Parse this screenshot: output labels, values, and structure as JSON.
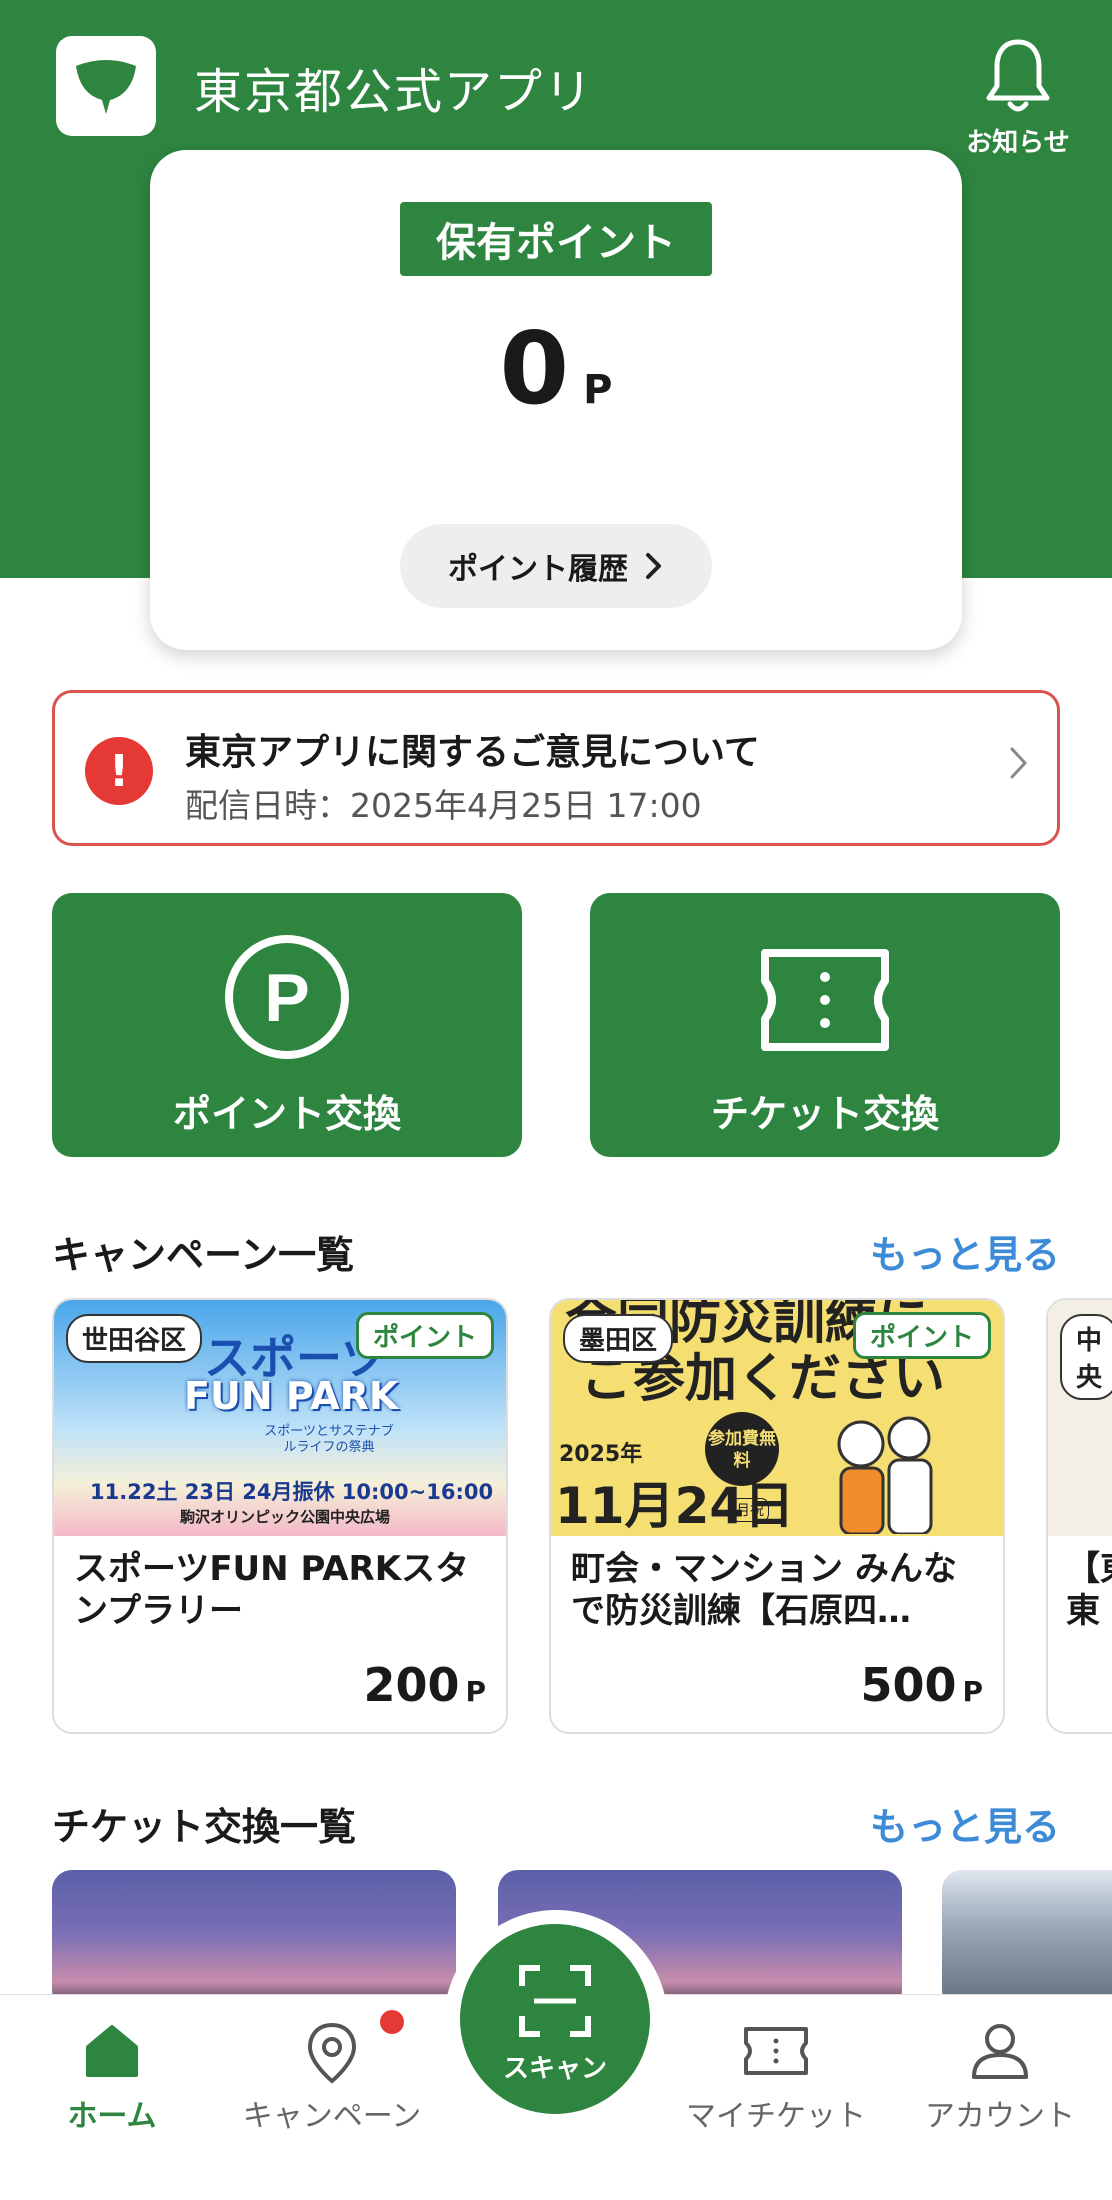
{
  "header": {
    "app_title": "東京都公式アプリ",
    "notification_label": "お知らせ"
  },
  "points": {
    "badge": "保有ポイント",
    "value": "0",
    "unit": "P",
    "history_label": "ポイント履歴"
  },
  "notice": {
    "title": "東京アプリに関するご意見について",
    "date": "配信日時：2025年4月25日 17:00"
  },
  "tiles": {
    "point_exchange": "ポイント交換",
    "ticket_exchange": "チケット交換"
  },
  "campaigns": {
    "section_title": "キャンペーン一覧",
    "more_label": "もっと見る",
    "items": [
      {
        "ward": "世田谷区",
        "tag": "ポイント",
        "title": "スポーツFUN PARKスタンプラリー",
        "points": "200",
        "unit": "P",
        "banner_line1": "スポーツ",
        "banner_line2": "FUN PARK",
        "banner_sub": "スポーツとサステナブルライフの祭典",
        "banner_dates": "11.22土 23日 24月振休 10:00~16:00",
        "banner_venue": "駒沢オリンピック公園中央広場"
      },
      {
        "ward": "墨田区",
        "tag": "ポイント",
        "title": "町会・マンション みんなで防災訓練【石原四…",
        "points": "500",
        "unit": "P",
        "banner_line1": "合同防災訓練に",
        "banner_line2": "ご参加ください",
        "banner_year": "2025年",
        "banner_date": "11月24日",
        "banner_dow": "月祝",
        "banner_free": "参加費無料"
      },
      {
        "ward": "中央",
        "title": "【東 東京"
      }
    ]
  },
  "tickets": {
    "section_title": "チケット交換一覧",
    "more_label": "もっと見る"
  },
  "nav": {
    "home": "ホーム",
    "campaign": "キャンペーン",
    "scan": "スキャン",
    "my_ticket": "マイチケット",
    "account": "アカウント"
  },
  "colors": {
    "brand_green": "#2e8540",
    "link_blue": "#3d8bd6",
    "alert_red": "#e53935"
  }
}
